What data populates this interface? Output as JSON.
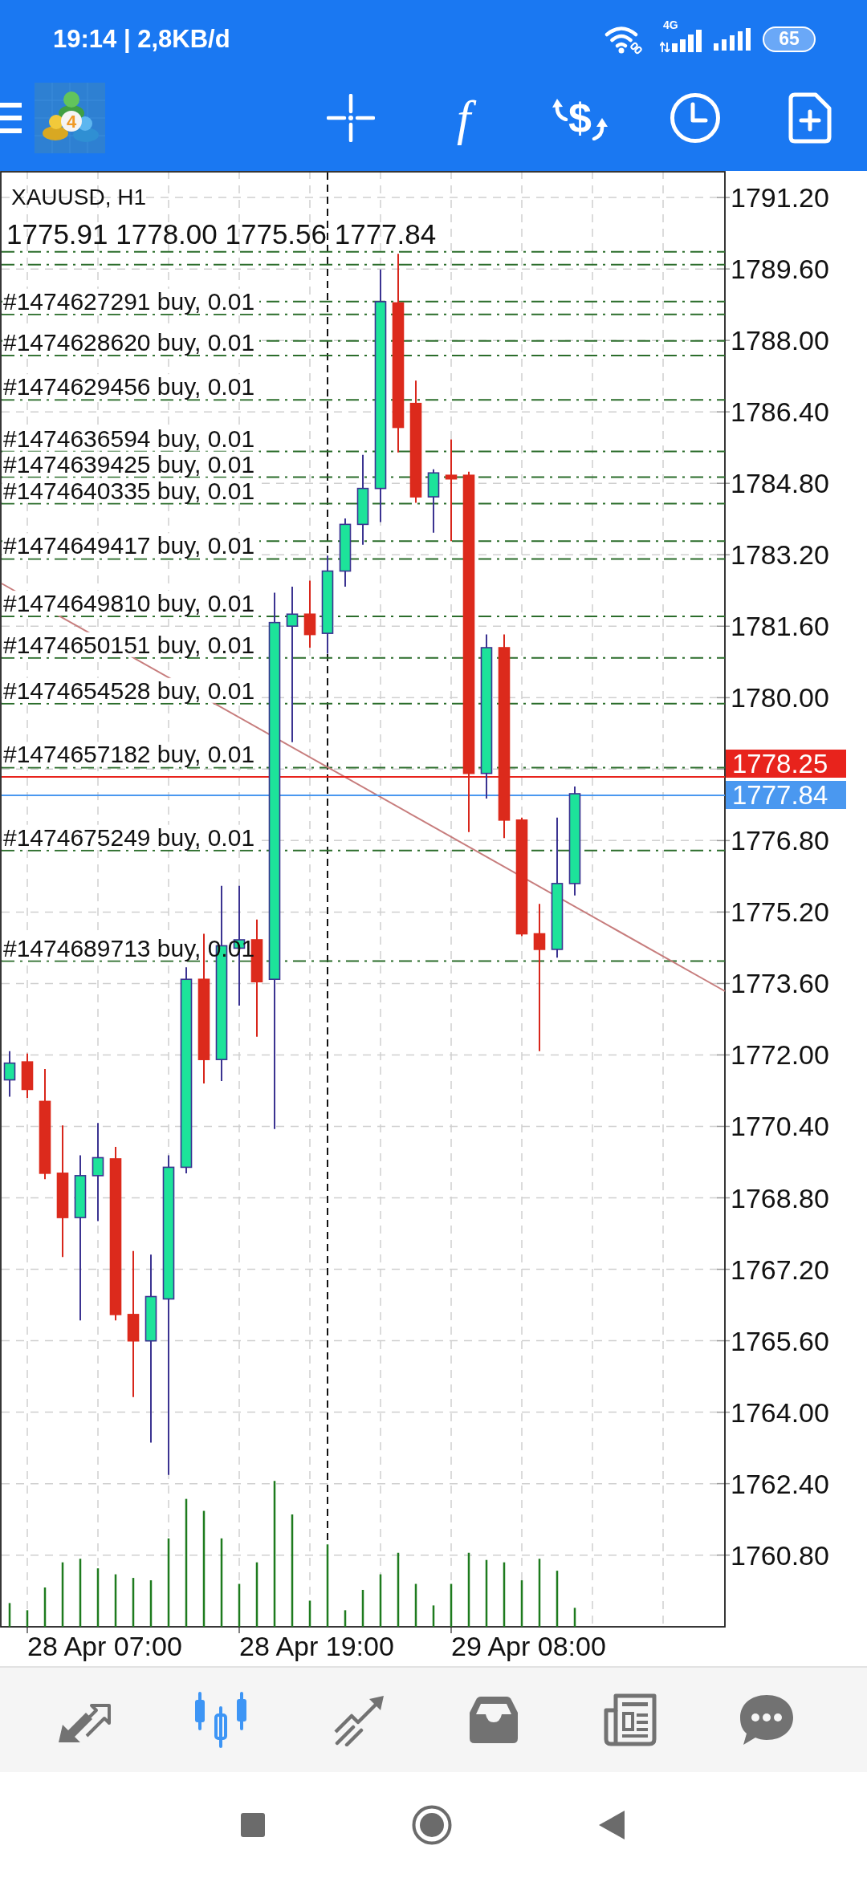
{
  "status_bar": {
    "time": "19:14 | 2,8KB/d",
    "network": "4G",
    "battery": "65"
  },
  "app_bar": {
    "logo_text": "4",
    "tools": [
      {
        "kind": "crosshair"
      },
      {
        "kind": "indicators",
        "glyph": "f"
      },
      {
        "kind": "trade",
        "glyph": "$"
      },
      {
        "kind": "period"
      },
      {
        "kind": "order"
      }
    ]
  },
  "chart": {
    "symbol": "XAUUSD, H1",
    "ohlc": "1775.91 1778.00 1775.56 1777.84",
    "orders": [
      {
        "label": "#1474627291 buy, 0.01"
      },
      {
        "label": "#1474628620 buy, 0.01"
      },
      {
        "label": "#1474629456 buy, 0.01"
      },
      {
        "label": "#1474636594 buy, 0.01"
      },
      {
        "label": "#1474639425 buy, 0.01"
      },
      {
        "label": "#1474640335 buy, 0.01"
      },
      {
        "label": "#1474649417 buy, 0.01"
      },
      {
        "label": "#1474649810 buy, 0.01"
      },
      {
        "label": "#1474650151 buy, 0.01"
      },
      {
        "label": "#1474654528 buy, 0.01"
      },
      {
        "label": "#1474657182 buy, 0.01"
      },
      {
        "label": "#1474675249 buy, 0.01"
      },
      {
        "label": "#1474689713 buy, 0.01"
      }
    ],
    "price_lines": [
      {
        "label": "1778.25",
        "color": "#e8231c"
      },
      {
        "label": "1777.84",
        "color": "#4a98f0"
      }
    ],
    "price_axis": [
      "1791.20",
      "1789.60",
      "1788.00",
      "1786.40",
      "1784.80",
      "1783.20",
      "1781.60",
      "1780.00",
      "1776.80",
      "1775.20",
      "1773.60",
      "1772.00",
      "1770.40",
      "1768.80",
      "1767.20",
      "1765.60",
      "1764.00",
      "1762.40",
      "1760.80"
    ],
    "time_axis": [
      "28 Apr 07:00",
      "28 Apr 19:00",
      "29 Apr 08:00"
    ]
  },
  "bottom_nav": [
    {
      "kind": "quotes",
      "selected": false
    },
    {
      "kind": "chart",
      "selected": true
    },
    {
      "kind": "trade",
      "selected": false
    },
    {
      "kind": "history",
      "selected": false
    },
    {
      "kind": "news",
      "selected": false
    },
    {
      "kind": "chat",
      "selected": false
    }
  ]
}
